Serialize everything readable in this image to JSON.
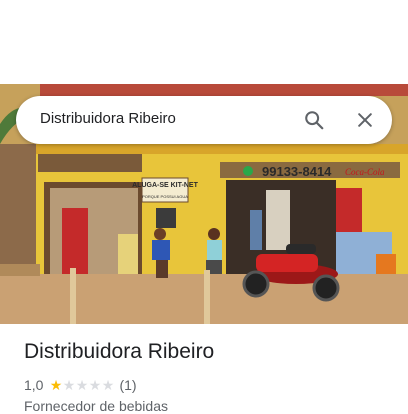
{
  "search": {
    "query": "Distribuidora Ribeiro",
    "search_icon": "search-icon",
    "close_icon": "close-icon"
  },
  "photo": {
    "phone_sign": "99133-8414",
    "brand_sign": "Coca-Cola",
    "rent_sign": "ALUGA-SE KIT-NET",
    "rent_sign_line3": "PORQUE POSSUI AGUA"
  },
  "place": {
    "name": "Distribuidora Ribeiro",
    "rating": "1,0",
    "rating_value": 1,
    "rating_max": 5,
    "review_count": "(1)",
    "category": "Fornecedor de bebidas"
  },
  "colors": {
    "star_filled": "#fbbc04",
    "star_empty": "#dadce0",
    "wall": "#e8c53a"
  }
}
